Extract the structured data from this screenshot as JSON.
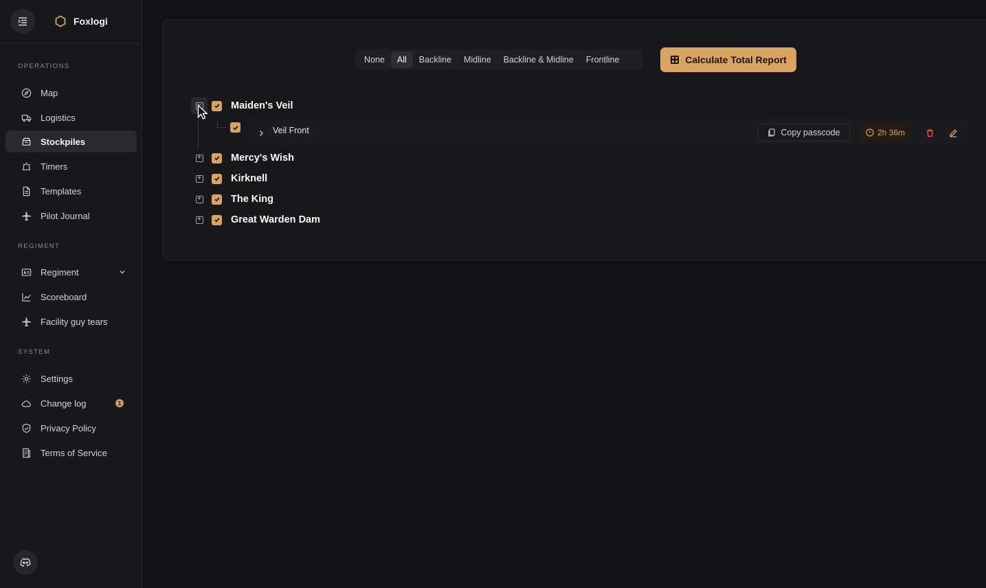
{
  "app": {
    "name": "Foxlogi"
  },
  "sidebar": {
    "sections": [
      {
        "title": "OPERATIONS",
        "items": [
          {
            "label": "Map",
            "icon": "compass-icon"
          },
          {
            "label": "Logistics",
            "icon": "truck-icon"
          },
          {
            "label": "Stockpiles",
            "icon": "box-icon",
            "active": true
          },
          {
            "label": "Timers",
            "icon": "alarm-icon"
          },
          {
            "label": "Templates",
            "icon": "file-icon"
          },
          {
            "label": "Pilot Journal",
            "icon": "plane-icon"
          }
        ]
      },
      {
        "title": "REGIMENT",
        "items": [
          {
            "label": "Regiment",
            "icon": "id-card-icon"
          },
          {
            "label": "Scoreboard",
            "icon": "chart-line-icon"
          },
          {
            "label": "Facility guy tears",
            "icon": "plane-icon"
          }
        ]
      },
      {
        "title": "SYSTEM",
        "items": [
          {
            "label": "Settings",
            "icon": "gear-icon"
          },
          {
            "label": "Change log",
            "icon": "cloud-icon",
            "badge": "1"
          },
          {
            "label": "Privacy Policy",
            "icon": "shield-icon"
          },
          {
            "label": "Terms of Service",
            "icon": "document-icon"
          }
        ]
      }
    ]
  },
  "filters": {
    "options": [
      "None",
      "All",
      "Backline",
      "Midline",
      "Backline & Midline",
      "Frontline"
    ],
    "selected": "All"
  },
  "calculate_button": {
    "label": "Calculate Total Report"
  },
  "regions": [
    {
      "name": "Maiden's Veil",
      "checked": true,
      "expanded": true,
      "children": [
        {
          "name": "Veil Front",
          "checked": true,
          "copy_label": "Copy passcode",
          "timer": "2h 36m"
        }
      ]
    },
    {
      "name": "Mercy's Wish",
      "checked": true,
      "expanded": false
    },
    {
      "name": "Kirknell",
      "checked": true,
      "expanded": false
    },
    {
      "name": "The King",
      "checked": true,
      "expanded": false
    },
    {
      "name": "Great Warden Dam",
      "checked": true,
      "expanded": false
    }
  ],
  "colors": {
    "accent": "#d9a45f",
    "background": "#111113",
    "sidebar": "#18181b",
    "danger": "#e05a5a"
  }
}
